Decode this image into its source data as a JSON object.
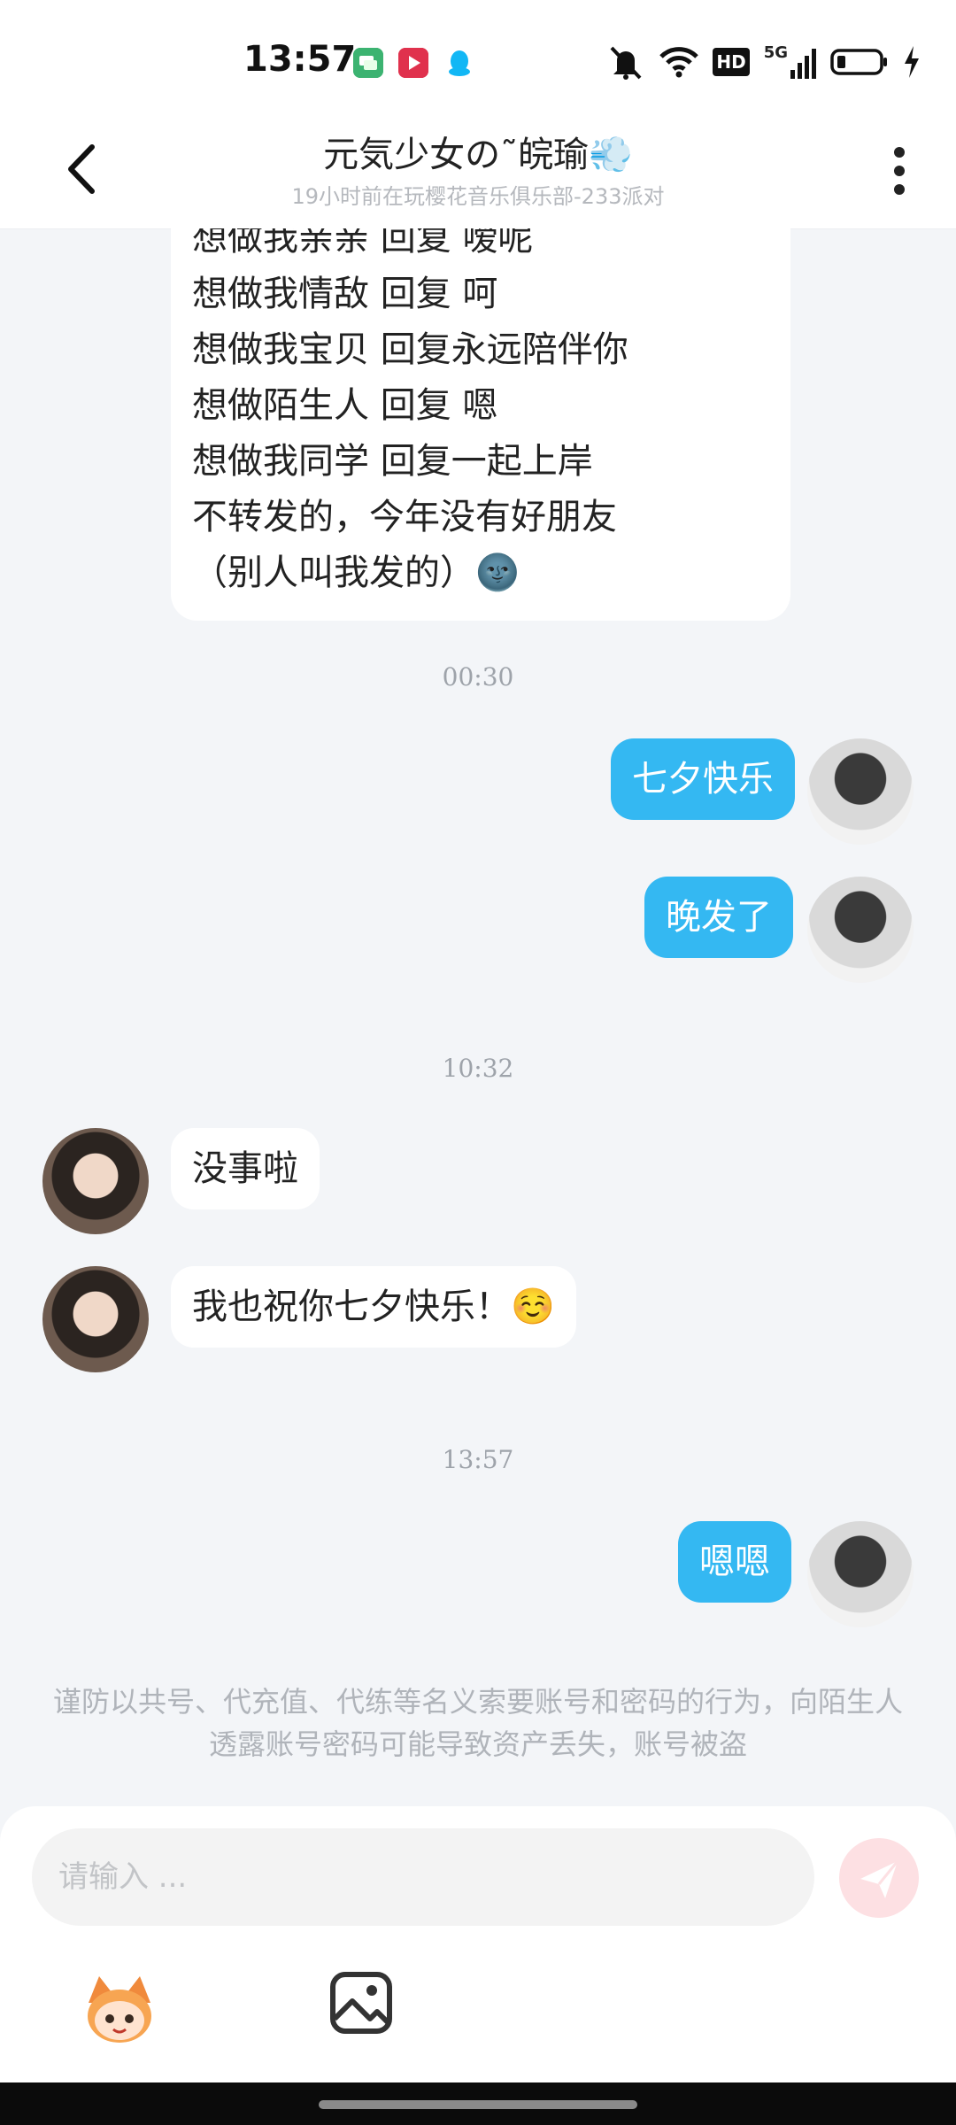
{
  "status_bar": {
    "time": "13:57",
    "icons": [
      "message-app-icon",
      "video-app-icon",
      "qq-penguin-icon",
      "mute-icon",
      "wifi-icon",
      "hd-icon",
      "signal-5g-icon",
      "battery-icon",
      "charging-icon"
    ],
    "network_label": "5G",
    "hd_label": "HD"
  },
  "header": {
    "title": "元気少女の˜皖瑜💨",
    "subtitle": "19小时前在玩樱花音乐俱乐部-233派对"
  },
  "messages": {
    "long_message_lines": [
      "想做我亲亲 回复 嗳呢",
      "想做我情敌  回复  呵",
      "想做我宝贝  回复永远陪伴你",
      "想做陌生人  回复  嗯",
      "想做我同学  回复一起上岸",
      "不转发的，今年没有好朋友",
      "（别人叫我发的）🌚"
    ],
    "ts1": "00:30",
    "m1": "七夕快乐",
    "m2": "晚发了",
    "ts2": "10:32",
    "m3": "没事啦",
    "m4": "我也祝你七夕快乐！☺️",
    "ts3": "13:57",
    "m5": "嗯嗯"
  },
  "notice": "谨防以共号、代充值、代练等名义索要账号和密码的行为，向陌生人透露账号密码可能导致资产丢失，账号被盗",
  "composer": {
    "placeholder": "请输入 ..."
  },
  "colors": {
    "accent_bubble": "#34b8f2",
    "background": "#f3f5f8",
    "send_button": "#fde0e3"
  }
}
